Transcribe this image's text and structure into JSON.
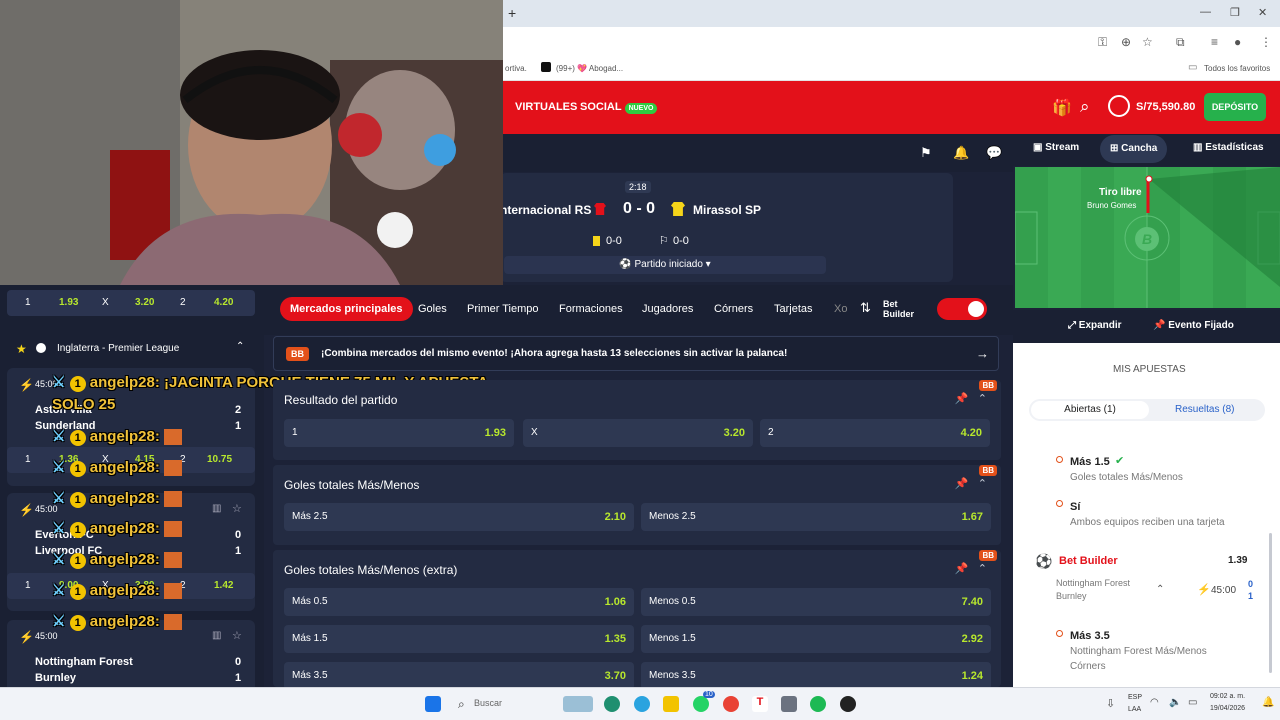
{
  "browser": {
    "new_tab": "+",
    "bookmarks": [
      "ortiva.",
      "(99+) 💖 Abogad...",
      "Todos los favoritos"
    ]
  },
  "header": {
    "nav": [
      "VIRTUALES",
      "SOCIAL"
    ],
    "new_badge": "NUEVO",
    "balance": "S/75,590.80",
    "deposit": "DEPÓSITO"
  },
  "view_tabs": [
    "Stream",
    "Cancha",
    "Estadísticas"
  ],
  "match": {
    "clock": "2:18",
    "home": "nternacional RS",
    "score": "0 - 0",
    "away": "Mirassol SP",
    "cards": "0-0",
    "corners": "0-0",
    "status": "Partido iniciado"
  },
  "pitch": {
    "event": "Tiro libre",
    "player": "Bruno Gomes",
    "logo": "B",
    "expand": "Expandir",
    "fixed": "Evento Fijado"
  },
  "left": {
    "top_odds": [
      "1",
      "1.93",
      "X",
      "3.20",
      "2",
      "4.20"
    ],
    "league": "Inglaterra - Premier League",
    "match1": {
      "time": "45:00",
      "home": "Aston Villa",
      "away": "Sunderland",
      "hs": "2",
      "as": "1",
      "odds": [
        "1",
        "1.36",
        "X",
        "4.15",
        "2",
        "10.75"
      ]
    },
    "match2": {
      "time": "45:00",
      "home": "Everton FC",
      "away": "Liverpool FC",
      "hs": "0",
      "as": "1",
      "odds": [
        "1",
        "9.00",
        "X",
        "3.80",
        "2",
        "1.42"
      ]
    },
    "match3": {
      "time": "45:00",
      "home": "Nottingham Forest",
      "away": "Burnley",
      "hs": "0",
      "as": "1"
    }
  },
  "chat": {
    "user": "angelp28:",
    "message1": "¡JACINTA PORQUE TIENE 75 MIL Y APUESTA",
    "message2": "SOLO 25"
  },
  "market_tabs": [
    "Mercados principales",
    "Goles",
    "Primer Tiempo",
    "Formaciones",
    "Jugadores",
    "Córners",
    "Tarjetas",
    "Xo"
  ],
  "bet_builder_label": "Bet Builder",
  "promo": {
    "badge": "BB",
    "text": "¡Combina mercados del mismo evento! ¡Ahora agrega hasta 13 selecciones sin activar la palanca!"
  },
  "markets": [
    {
      "title": "Resultado del partido",
      "odds": [
        [
          "1",
          "1.93"
        ],
        [
          "X",
          "3.20"
        ],
        [
          "2",
          "4.20"
        ]
      ]
    },
    {
      "title": "Goles totales Más/Menos",
      "odds": [
        [
          "Más 2.5",
          "2.10"
        ],
        [
          "Menos 2.5",
          "1.67"
        ]
      ]
    },
    {
      "title": "Goles totales Más/Menos (extra)",
      "rows": [
        [
          [
            "Más 0.5",
            "1.06"
          ],
          [
            "Menos 0.5",
            "7.40"
          ]
        ],
        [
          [
            "Más 1.5",
            "1.35"
          ],
          [
            "Menos 1.5",
            "2.92"
          ]
        ],
        [
          [
            "Más 3.5",
            "3.70"
          ],
          [
            "Menos 3.5",
            "1.24"
          ]
        ]
      ]
    }
  ],
  "bets": {
    "title": "MIS APUESTAS",
    "open": "Abiertas (1)",
    "resolved": "Resueltas (8)",
    "sel1": {
      "title": "Más 1.5",
      "sub": "Goles totales Más/Menos"
    },
    "sel2": {
      "title": "Sí",
      "sub": "Ambos equipos reciben una tarjeta"
    },
    "builder": {
      "label": "Bet Builder",
      "odds": "1.39",
      "home": "Nottingham Forest",
      "away": "Burnley",
      "time": "45:00",
      "hs": "0",
      "as": "1"
    },
    "sel3": {
      "title": "Más 3.5",
      "sub1": "Nottingham Forest Más/Menos",
      "sub2": "Córners"
    }
  },
  "taskbar": {
    "search": "Buscar",
    "lang1": "ESP",
    "lang2": "LAA",
    "time": "09:02 a. m.",
    "date": "19/04/2026",
    "notif": "10"
  }
}
